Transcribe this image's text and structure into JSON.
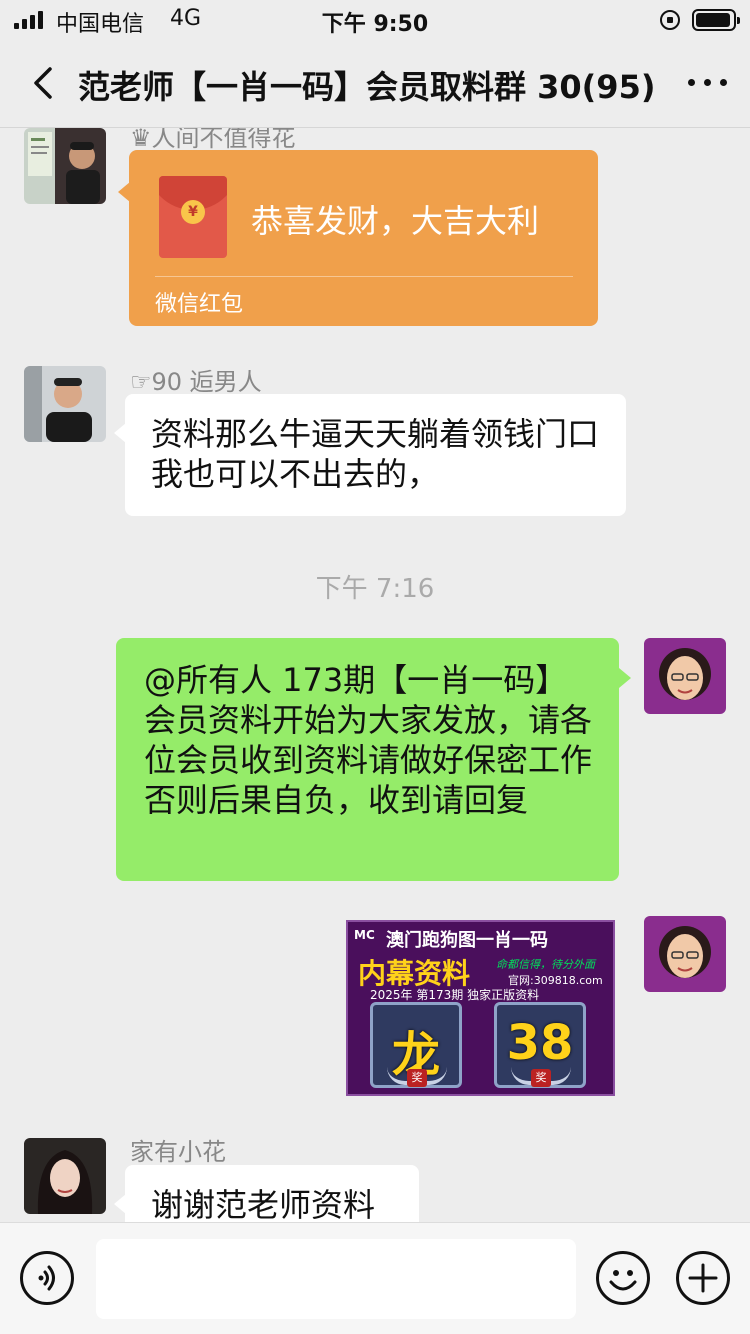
{
  "status_bar": {
    "carrier": "中国电信",
    "network": "4G",
    "time": "下午 9:50"
  },
  "nav": {
    "title": "范老师【一肖一码】会员取料群 30(95)"
  },
  "messages": {
    "m1": {
      "sender": "♛人间不值得花",
      "packet_wish": "恭喜发财，大吉大利",
      "packet_label": "微信红包",
      "packet_coin": "¥"
    },
    "m2": {
      "sender": "☞90 逅男人",
      "text": "资料那么牛逼天天躺着领钱门口我也可以不出去的，"
    },
    "timestamp": "下午 7:16",
    "m3": {
      "text": "@所有人 173期【一肖一码】会员资料开始为大家发放，请各位会员收到资料请做好保密工作否则后果自负，收到请回复"
    },
    "m4": {
      "promo_logo": "MC",
      "promo_title": "澳门跑狗图一肖一码",
      "promo_inner": "内幕资料",
      "promo_slogan": "命都信得，待分外面",
      "promo_site": "官网:309818.com",
      "promo_issue": "2025年  第173期  独家正版资料",
      "promo_zodiac": "龙",
      "promo_number": "38",
      "promo_badge_label": "奖"
    },
    "m5": {
      "sender": "家有小花",
      "text": "谢谢范老师资料"
    }
  },
  "colors": {
    "background": "#ededed",
    "green_bubble": "#95ec69",
    "red_packet": "#f0a04b"
  },
  "icons": [
    "back-chevron-icon",
    "more-dots-icon",
    "voice-icon",
    "emoji-icon",
    "plus-icon"
  ]
}
